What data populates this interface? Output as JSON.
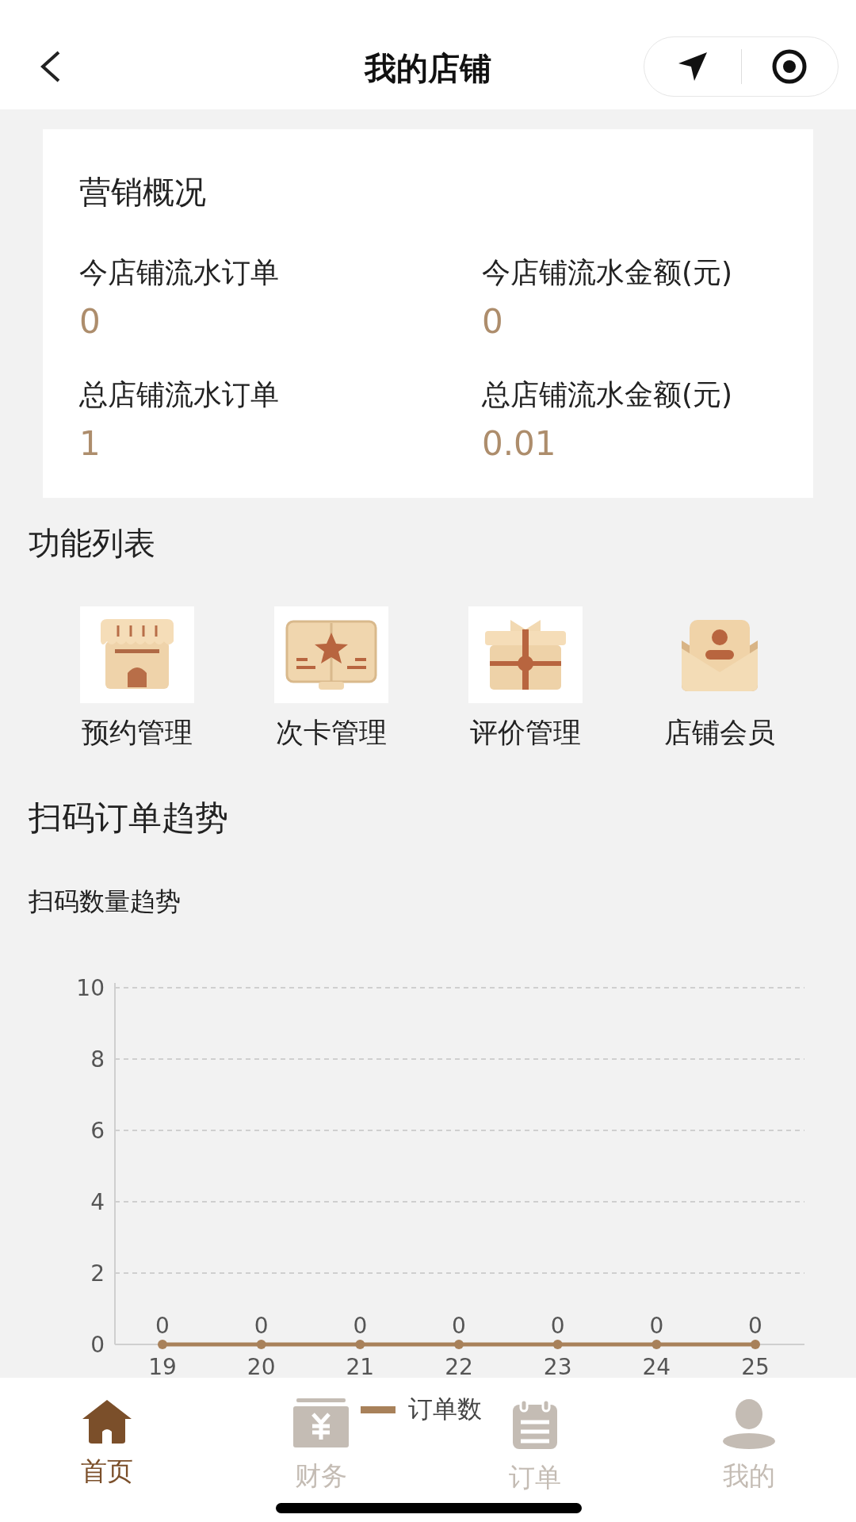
{
  "header": {
    "title": "我的店铺"
  },
  "overview": {
    "title": "营销概况",
    "stats": [
      {
        "label": "今店铺流水订单",
        "value": "0"
      },
      {
        "label": "今店铺流水金额(元)",
        "value": "0"
      },
      {
        "label": "总店铺流水订单",
        "value": "1"
      },
      {
        "label": "总店铺流水金额(元)",
        "value": "0.01"
      }
    ]
  },
  "functions": {
    "title": "功能列表",
    "items": [
      {
        "kind": "shop",
        "label": "预约管理"
      },
      {
        "kind": "card",
        "label": "次卡管理"
      },
      {
        "kind": "gift",
        "label": "评价管理"
      },
      {
        "kind": "member",
        "label": "店铺会员"
      }
    ]
  },
  "trend": {
    "title": "扫码订单趋势",
    "subtitle": "扫码数量趋势",
    "chart_data": {
      "type": "line",
      "categories": [
        "19",
        "20",
        "21",
        "22",
        "23",
        "24",
        "25"
      ],
      "series": [
        {
          "name": "订单数",
          "color": "#a8815a",
          "marker": "circle",
          "values": [
            0,
            0,
            0,
            0,
            0,
            0,
            0
          ]
        }
      ],
      "grid": true,
      "ylim": [
        0,
        10
      ],
      "yticks": [
        0,
        2,
        4,
        6,
        8,
        10
      ],
      "data_labels": true
    }
  },
  "tab_bar": [
    {
      "kind": "home",
      "label": "首页",
      "selected": true
    },
    {
      "kind": "finance",
      "label": "财务",
      "selected": false
    },
    {
      "kind": "orders",
      "label": "订单",
      "selected": false
    },
    {
      "kind": "profile",
      "label": "我的",
      "selected": false
    }
  ]
}
